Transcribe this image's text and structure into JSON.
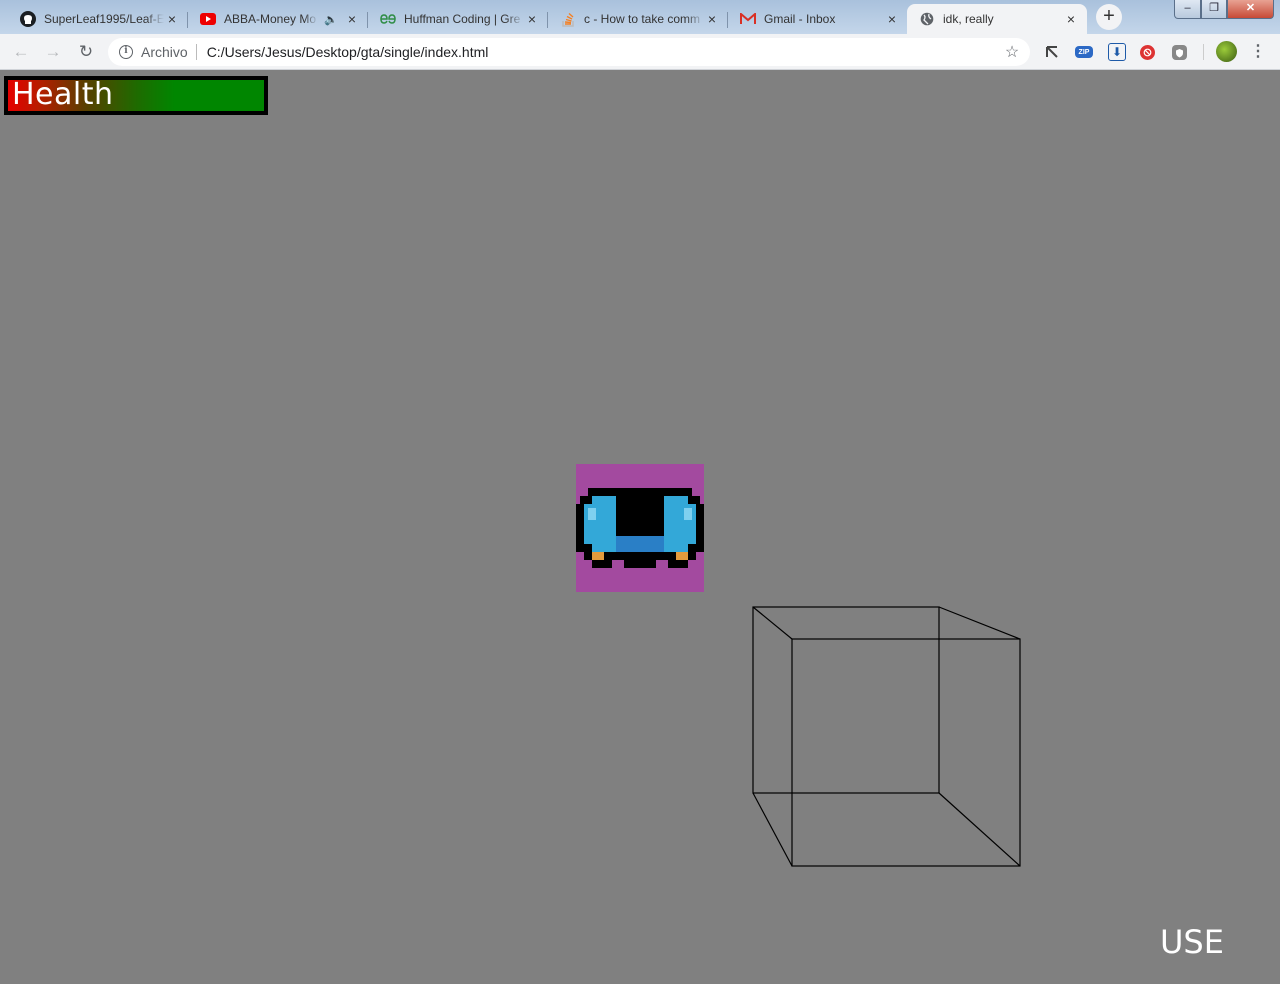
{
  "browser": {
    "tabs": [
      {
        "title": "SuperLeaf1995/Leaf-E",
        "favicon": "github-icon",
        "audio": false,
        "active": false
      },
      {
        "title": "ABBA-Money Mo",
        "favicon": "youtube-icon",
        "audio": true,
        "active": false
      },
      {
        "title": "Huffman Coding | Gre",
        "favicon": "geeksforgeeks-icon",
        "audio": false,
        "active": false
      },
      {
        "title": "c - How to take comm",
        "favicon": "stackoverflow-icon",
        "audio": false,
        "active": false
      },
      {
        "title": "Gmail - Inbox",
        "favicon": "gmail-icon",
        "audio": false,
        "active": false
      },
      {
        "title": "idk, really",
        "favicon": "globe-icon",
        "audio": false,
        "active": true
      }
    ],
    "omnibox": {
      "scheme_chip": "Archivo",
      "url": "C:/Users/Jesus/Desktop/gta/single/index.html"
    },
    "icons": {
      "close": "×",
      "new_tab": "+",
      "audio": "🔈",
      "back": "←",
      "forward": "→",
      "reload": "↻",
      "info": "i",
      "star": "☆",
      "menu": "⋮",
      "zip_ext": "ZIP",
      "download_ext": "⬇",
      "window_min": "–",
      "window_max": "❐",
      "window_close": "✕"
    },
    "extensions": [
      "cursor-extension-icon",
      "zip-extension-icon",
      "download-extension-icon",
      "block-extension-icon",
      "shield-extension-icon"
    ]
  },
  "game": {
    "health_label": "Health",
    "use_label": "USE",
    "colors": {
      "background": "#808080",
      "health_low": "#e60000",
      "health_high": "#008600",
      "player_bg": "#a34a9f",
      "player_body": "#33a8d8",
      "cube_stroke": "#000000"
    }
  }
}
